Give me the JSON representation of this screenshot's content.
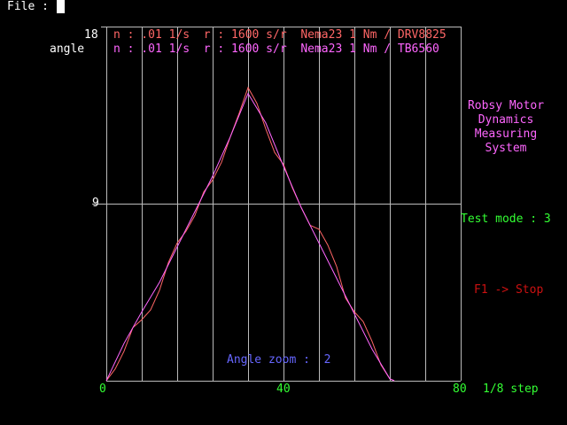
{
  "menu": {
    "file_label": "File :"
  },
  "legend": {
    "line1": "n : .01 1/s  r : 1600 s/r  Nema23 1 Nm / DRV8825",
    "line2": "n : .01 1/s  r : 1600 s/r  Nema23 1 Nm / TB6560",
    "color1": "#ff6666",
    "color2": "#ff66ff"
  },
  "title": [
    "Robsy Motor",
    "Dynamics",
    "Measuring",
    "System"
  ],
  "status": {
    "test_mode": "Test mode : 3",
    "f1_hint": "F1 -> Stop",
    "angle_zoom": "Angle zoom :  2"
  },
  "colors": {
    "background": "#000000",
    "grid": "#bbbbbb",
    "green": "#33ff33",
    "magenta": "#ff66ff",
    "salmon": "#ff6666",
    "red": "#cc1111",
    "blue": "#6666ff"
  },
  "chart_data": {
    "type": "line",
    "xlabel": "1/8 step",
    "ylabel": "angle",
    "xlim": [
      0,
      80
    ],
    "ylim": [
      0,
      18
    ],
    "x_ticks": [
      "0",
      "40",
      "80"
    ],
    "y_ticks": [
      "9",
      "18"
    ],
    "grid": true,
    "series": [
      {
        "name": "n : .01 1/s  r : 1600 s/r  Nema23 1 Nm / DRV8825",
        "color": "#ff6666",
        "points": [
          [
            0,
            0
          ],
          [
            2,
            0.6
          ],
          [
            4,
            1.5
          ],
          [
            6,
            2.7
          ],
          [
            8,
            3.1
          ],
          [
            10,
            3.6
          ],
          [
            12,
            4.6
          ],
          [
            14,
            6.0
          ],
          [
            16,
            7.0
          ],
          [
            18,
            7.6
          ],
          [
            20,
            8.4
          ],
          [
            22,
            9.6
          ],
          [
            24,
            10.2
          ],
          [
            26,
            11.1
          ],
          [
            28,
            12.4
          ],
          [
            30,
            13.6
          ],
          [
            32,
            14.9
          ],
          [
            34,
            14.1
          ],
          [
            36,
            12.8
          ],
          [
            38,
            11.6
          ],
          [
            40,
            11.0
          ],
          [
            42,
            9.8
          ],
          [
            44,
            8.8
          ],
          [
            46,
            7.9
          ],
          [
            48,
            7.7
          ],
          [
            50,
            6.9
          ],
          [
            52,
            5.8
          ],
          [
            54,
            4.2
          ],
          [
            56,
            3.5
          ],
          [
            58,
            3.0
          ],
          [
            60,
            2.0
          ],
          [
            62,
            0.8
          ],
          [
            64,
            0.1
          ],
          [
            65,
            0
          ]
        ]
      },
      {
        "name": "n : .01 1/s  r : 1600 s/r  Nema23 1 Nm / TB6560",
        "color": "#ff66ff",
        "points": [
          [
            0,
            0
          ],
          [
            4,
            1.9
          ],
          [
            8,
            3.5
          ],
          [
            12,
            5.0
          ],
          [
            16,
            6.8
          ],
          [
            20,
            8.6
          ],
          [
            24,
            10.4
          ],
          [
            28,
            12.4
          ],
          [
            32,
            14.6
          ],
          [
            36,
            13.1
          ],
          [
            40,
            10.9
          ],
          [
            44,
            8.8
          ],
          [
            48,
            7.0
          ],
          [
            52,
            5.2
          ],
          [
            56,
            3.4
          ],
          [
            60,
            1.6
          ],
          [
            64,
            0.1
          ],
          [
            65,
            0
          ]
        ]
      }
    ]
  }
}
